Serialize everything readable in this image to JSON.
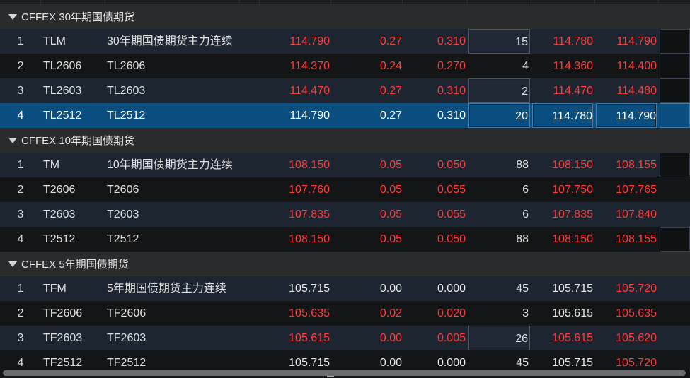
{
  "groups": [
    {
      "title": "CFFEX 30年期国债期货",
      "rows": [
        {
          "idx": "1",
          "code": "TLM",
          "name": "30年期国债期货主力连续",
          "last": "114.790",
          "chg": "0.27",
          "pct": "0.310",
          "vol": "15",
          "bid": "114.780",
          "ask": "114.790"
        },
        {
          "idx": "2",
          "code": "TL2606",
          "name": "TL2606",
          "last": "114.370",
          "chg": "0.24",
          "pct": "0.270",
          "vol": "4",
          "bid": "114.360",
          "ask": "114.400"
        },
        {
          "idx": "3",
          "code": "TL2603",
          "name": "TL2603",
          "last": "114.470",
          "chg": "0.27",
          "pct": "0.310",
          "vol": "2",
          "bid": "114.470",
          "ask": "114.480"
        },
        {
          "idx": "4",
          "code": "TL2512",
          "name": "TL2512",
          "last": "114.790",
          "chg": "0.27",
          "pct": "0.310",
          "vol": "20",
          "bid": "114.780",
          "ask": "114.790"
        }
      ]
    },
    {
      "title": "CFFEX 10年期国债期货",
      "rows": [
        {
          "idx": "1",
          "code": "TM",
          "name": "10年期国债期货主力连续",
          "last": "108.150",
          "chg": "0.05",
          "pct": "0.050",
          "vol": "88",
          "bid": "108.150",
          "ask": "108.155"
        },
        {
          "idx": "2",
          "code": "T2606",
          "name": "T2606",
          "last": "107.760",
          "chg": "0.05",
          "pct": "0.055",
          "vol": "6",
          "bid": "107.750",
          "ask": "107.765"
        },
        {
          "idx": "3",
          "code": "T2603",
          "name": "T2603",
          "last": "107.835",
          "chg": "0.05",
          "pct": "0.055",
          "vol": "6",
          "bid": "107.835",
          "ask": "107.840"
        },
        {
          "idx": "4",
          "code": "T2512",
          "name": "T2512",
          "last": "108.150",
          "chg": "0.05",
          "pct": "0.050",
          "vol": "88",
          "bid": "108.150",
          "ask": "108.155"
        }
      ]
    },
    {
      "title": "CFFEX 5年期国债期货",
      "rows": [
        {
          "idx": "1",
          "code": "TFM",
          "name": "5年期国债期货主力连续",
          "last": "105.715",
          "chg": "0.00",
          "pct": "0.000",
          "vol": "45",
          "bid": "105.715",
          "ask": "105.720"
        },
        {
          "idx": "2",
          "code": "TF2606",
          "name": "TF2606",
          "last": "105.635",
          "chg": "0.02",
          "pct": "0.020",
          "vol": "3",
          "bid": "105.615",
          "ask": "105.635"
        },
        {
          "idx": "3",
          "code": "TF2603",
          "name": "TF2603",
          "last": "105.615",
          "chg": "0.00",
          "pct": "0.005",
          "vol": "26",
          "bid": "105.615",
          "ask": "105.620"
        },
        {
          "idx": "4",
          "code": "TF2512",
          "name": "TF2512",
          "last": "105.715",
          "chg": "0.00",
          "pct": "0.000",
          "vol": "45",
          "bid": "105.715",
          "ask": "105.720"
        }
      ]
    }
  ],
  "colors": {
    "up": "#ff3b3b",
    "flat": "#e8e8e8",
    "selected_row": "#0a4f80"
  },
  "icons": {
    "group_toggle": "caret-down-icon"
  }
}
